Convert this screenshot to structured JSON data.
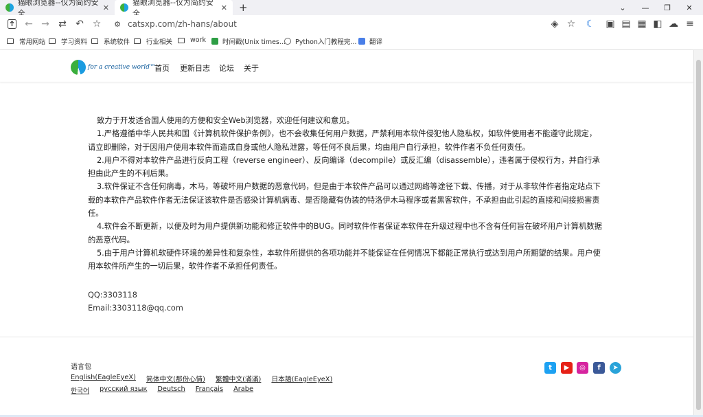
{
  "tabs": [
    {
      "title": "猫眼浏览器--仅为简约安全",
      "close": "✕"
    },
    {
      "title": "猫眼浏览器--仅为简约安全",
      "close": "✕"
    }
  ],
  "new_tab": "+",
  "window_controls": [
    "⌄",
    "—",
    "❐",
    "✕"
  ],
  "toolbar": {
    "url": "catsxp.com/zh-hans/about"
  },
  "bookmarks": [
    {
      "label": "常用网站"
    },
    {
      "label": "学习资料"
    },
    {
      "label": "系统软件"
    },
    {
      "label": "行业相关"
    },
    {
      "label": "work"
    },
    {
      "label": "时间戳(Unix times..."
    },
    {
      "label": "Python入门教程完..."
    },
    {
      "label": "翻译"
    }
  ],
  "site": {
    "logo_text": "for a creative world™",
    "nav": [
      "首页",
      "更新日志",
      "论坛",
      "关于"
    ]
  },
  "content": {
    "paragraphs": [
      "致力于开发适合国人使用的方便和安全Web浏览器，欢迎任何建议和意见。",
      "1.严格遵循中华人民共和国《计算机软件保护条例》，也不会收集任何用户数据，严禁利用本软件侵犯他人隐私权，如软件使用者不能遵守此规定，请立即删除，对于因用户使用本软件而造成自身或他人隐私泄露，等任何不良后果，均由用户自行承担，软件作者不负任何责任。",
      "2.用户不得对本软件产品进行反向工程（reverse engineer）、反向编译（decompile）或反汇编（disassemble），违者属于侵权行为，并自行承担由此产生的不利后果。",
      "3.软件保证不含任何病毒，木马，等破坏用户数据的恶意代码，但是由于本软件产品可以通过网络等途径下载、传播，对于从非软件作者指定站点下载的本软件产品软件作者无法保证该软件是否感染计算机病毒、是否隐藏有伪装的特洛伊木马程序或者黑客软件，不承担由此引起的直接和间接损害责任。",
      "4.软件会不断更新，以便及时为用户提供新功能和修正软件中的BUG。同时软件作者保证本软件在升级过程中也不含有任何旨在破坏用户计算机数据的恶意代码。",
      "5.由于用户计算机软硬件环境的差异性和复杂性，本软件所提供的各项功能并不能保证在任何情况下都能正常执行或达到用户所期望的结果。用户使用本软件所产生的一切后果，软件作者不承担任何责任。"
    ],
    "qq": "QQ:3303118",
    "email": "Email:3303118@qq.com"
  },
  "footer": {
    "lang_title": "语言包",
    "row1": [
      "English(EagleEyeX)",
      "简体中文(那份心情)",
      "繁體中文(滿滿)",
      "日本語(EagleEyeX)"
    ],
    "row2": [
      "한국어",
      "русский язык",
      "Deutsch",
      "Français",
      "Arabe"
    ]
  },
  "social": [
    {
      "name": "twitter",
      "color": "#1da1f2",
      "glyph": "t"
    },
    {
      "name": "youtube",
      "color": "#e62117",
      "glyph": "▶"
    },
    {
      "name": "instagram",
      "color": "#d6249f",
      "glyph": "◎"
    },
    {
      "name": "facebook",
      "color": "#3b5998",
      "glyph": "f"
    },
    {
      "name": "telegram",
      "color": "#2aa3d9",
      "glyph": "➤"
    }
  ]
}
